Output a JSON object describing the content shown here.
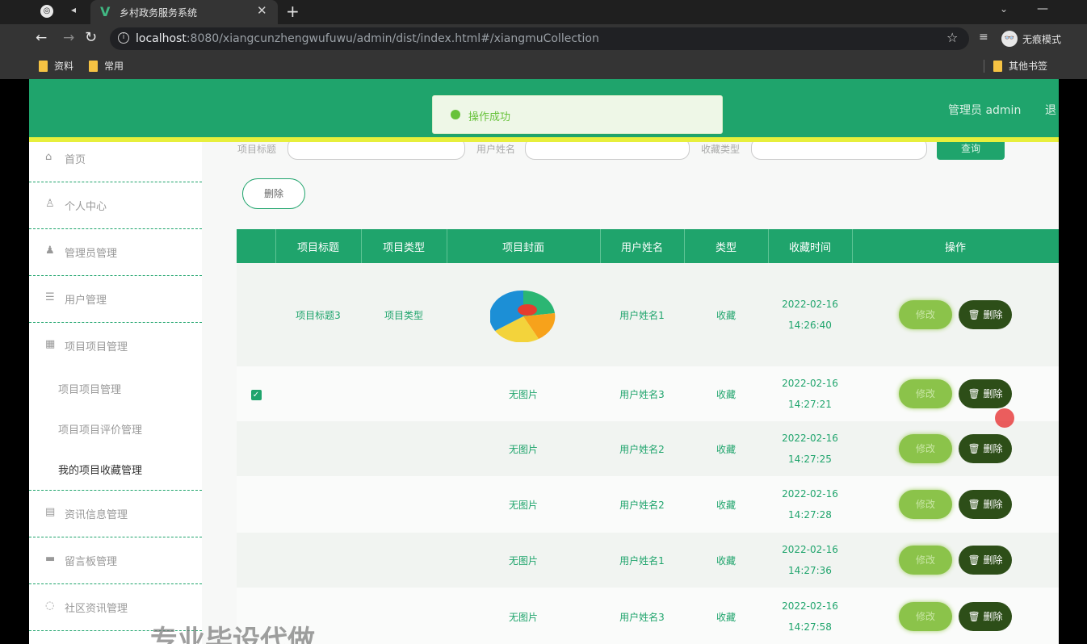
{
  "browser": {
    "tab_title": "乡村政务服务系统",
    "url_host": "localhost",
    "url_rest": ":8080/xiangcunzhengwufuwu/admin/dist/index.html#/xiangmuCollection",
    "profile_label": "无痕模式",
    "bookmarks": [
      "资料",
      "常用"
    ],
    "other_bookmarks": "其他书签"
  },
  "header": {
    "toast_text": "操作成功",
    "user_label": "管理员 admin",
    "exit_label": "退"
  },
  "sidebar": {
    "items": [
      {
        "label": "首页",
        "icon": "home-icon"
      },
      {
        "label": "个人中心",
        "icon": "user-icon"
      },
      {
        "label": "管理员管理",
        "icon": "admin-icon"
      },
      {
        "label": "用户管理",
        "icon": "users-icon"
      },
      {
        "label": "项目项目管理",
        "icon": "project-icon"
      }
    ],
    "sub_items": [
      {
        "label": "项目项目管理",
        "active": false
      },
      {
        "label": "项目项目评价管理",
        "active": false
      },
      {
        "label": "我的项目收藏管理",
        "active": true
      }
    ],
    "items_after": [
      {
        "label": "资讯信息管理",
        "icon": "news-icon"
      },
      {
        "label": "留言板管理",
        "icon": "message-icon"
      },
      {
        "label": "社区资讯管理",
        "icon": "community-icon"
      }
    ]
  },
  "search": {
    "labels": [
      "项目标题",
      "用户姓名",
      "收藏类型"
    ],
    "button": "查询"
  },
  "toolbar": {
    "delete_batch": "删除"
  },
  "table": {
    "columns": [
      "项目标题",
      "项目类型",
      "项目封面",
      "用户姓名",
      "类型",
      "收藏时间",
      "操作"
    ],
    "rows": [
      {
        "checked": false,
        "title": "项目标题3",
        "type": "项目类型",
        "cover": "image",
        "user": "用户姓名1",
        "kind": "收藏",
        "date": "2022-02-16",
        "time": "14:26:40"
      },
      {
        "checked": true,
        "title": "",
        "type": "",
        "cover": "无图片",
        "user": "用户姓名3",
        "kind": "收藏",
        "date": "2022-02-16",
        "time": "14:27:21"
      },
      {
        "checked": false,
        "title": "",
        "type": "",
        "cover": "无图片",
        "user": "用户姓名2",
        "kind": "收藏",
        "date": "2022-02-16",
        "time": "14:27:25"
      },
      {
        "checked": false,
        "title": "",
        "type": "",
        "cover": "无图片",
        "user": "用户姓名2",
        "kind": "收藏",
        "date": "2022-02-16",
        "time": "14:27:28"
      },
      {
        "checked": false,
        "title": "",
        "type": "",
        "cover": "无图片",
        "user": "用户姓名1",
        "kind": "收藏",
        "date": "2022-02-16",
        "time": "14:27:36"
      },
      {
        "checked": false,
        "title": "",
        "type": "",
        "cover": "无图片",
        "user": "用户姓名3",
        "kind": "收藏",
        "date": "2022-02-16",
        "time": "14:27:58"
      }
    ],
    "edit_label": "修改",
    "delete_label": "删除"
  },
  "watermark": "专业毕设代做",
  "colors": {
    "primary": "#1fa46c",
    "accent_yellow": "#e7ef3c",
    "edit_button": "#8bc34a",
    "delete_button": "#2d4e18"
  }
}
